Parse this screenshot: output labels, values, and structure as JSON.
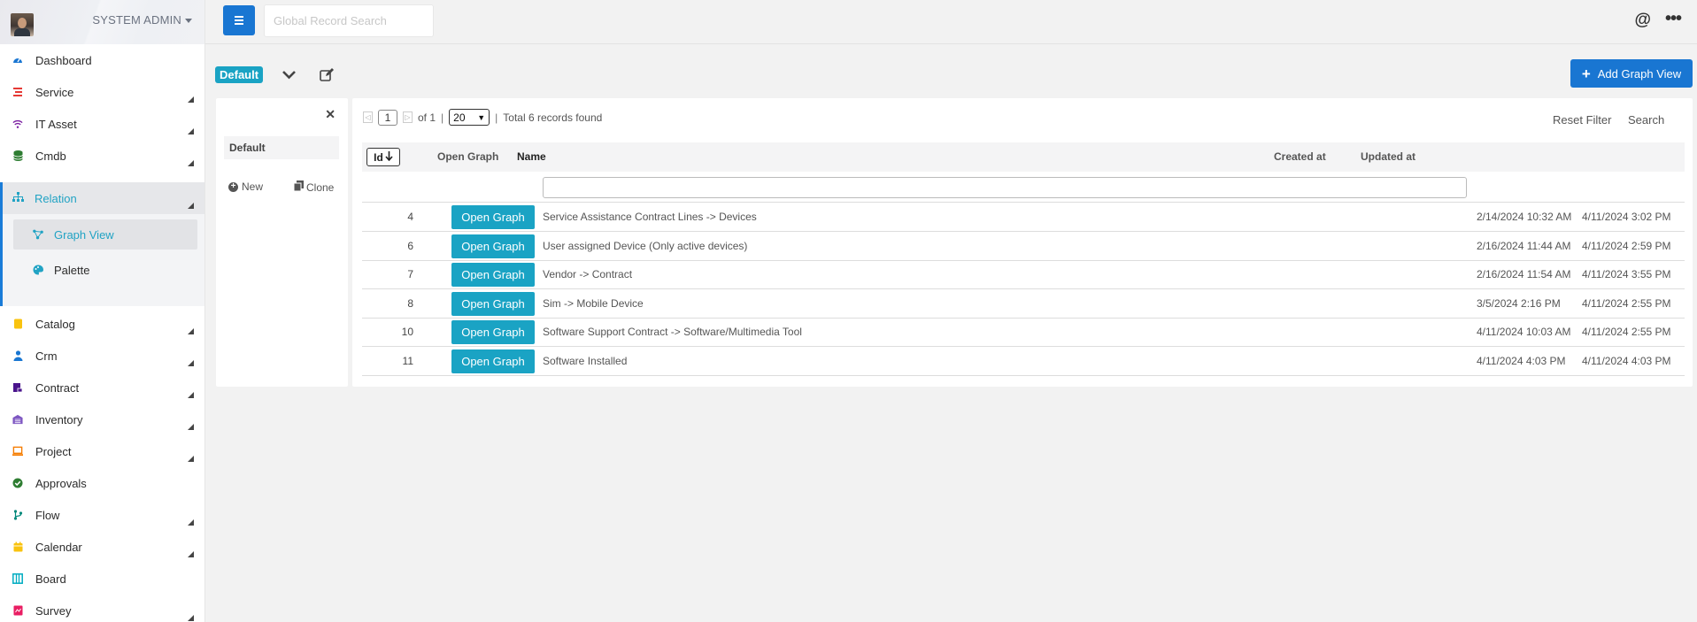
{
  "user": {
    "name": "SYSTEM ADMIN"
  },
  "topbar": {
    "search_placeholder": "Global Record Search"
  },
  "sidebar": {
    "items_top": [
      {
        "label": "Dashboard",
        "icon": "gauge-icon",
        "color": "#1976d2",
        "expandable": false
      },
      {
        "label": "Service",
        "icon": "list-icon",
        "color": "#e53935",
        "expandable": true
      },
      {
        "label": "IT Asset",
        "icon": "wifi-icon",
        "color": "#7b1fa2",
        "expandable": true
      },
      {
        "label": "Cmdb",
        "icon": "database-icon",
        "color": "#2e7d32",
        "expandable": true
      }
    ],
    "group": {
      "label": "Relation",
      "icon": "sitemap-icon",
      "color": "#21a3c4",
      "children": [
        {
          "label": "Graph View",
          "icon": "graph-icon",
          "active": true
        },
        {
          "label": "Palette",
          "icon": "palette-icon",
          "active": false
        }
      ]
    },
    "items_bottom": [
      {
        "label": "Catalog",
        "icon": "book-icon",
        "color": "#f9c30f",
        "expandable": true
      },
      {
        "label": "Crm",
        "icon": "user-icon",
        "color": "#1976d2",
        "expandable": true
      },
      {
        "label": "Contract",
        "icon": "contract-icon",
        "color": "#4a148c",
        "expandable": true
      },
      {
        "label": "Inventory",
        "icon": "warehouse-icon",
        "color": "#7e57c2",
        "expandable": true
      },
      {
        "label": "Project",
        "icon": "laptop-icon",
        "color": "#f57c00",
        "expandable": true
      },
      {
        "label": "Approvals",
        "icon": "check-circle-icon",
        "color": "#2e7d32",
        "expandable": false
      },
      {
        "label": "Flow",
        "icon": "flow-icon",
        "color": "#00897b",
        "expandable": true
      },
      {
        "label": "Calendar",
        "icon": "calendar-icon",
        "color": "#f9c30f",
        "expandable": true
      },
      {
        "label": "Board",
        "icon": "board-icon",
        "color": "#00acc1",
        "expandable": false
      },
      {
        "label": "Survey",
        "icon": "survey-icon",
        "color": "#e91e63",
        "expandable": true
      }
    ]
  },
  "viewbar": {
    "current_view": "Default",
    "add_label": "Add Graph View"
  },
  "views_panel": {
    "items": [
      "Default"
    ],
    "new_label": "New",
    "clone_label": "Clone"
  },
  "pager": {
    "page": "1",
    "of_text": "of 1",
    "page_size": "20",
    "total_text": "Total 6 records found"
  },
  "actions": {
    "reset_filter": "Reset Filter",
    "search": "Search"
  },
  "table": {
    "headers": {
      "id": "Id",
      "open_graph": "Open Graph",
      "name": "Name",
      "created": "Created at",
      "updated": "Updated at"
    },
    "button_label": "Open Graph",
    "rows": [
      {
        "id": "4",
        "name": "Service Assistance Contract Lines -> Devices",
        "created": "2/14/2024 10:32 AM",
        "updated": "4/11/2024 3:02 PM"
      },
      {
        "id": "6",
        "name": "User assigned Device (Only active devices)",
        "created": "2/16/2024 11:44 AM",
        "updated": "4/11/2024 2:59 PM"
      },
      {
        "id": "7",
        "name": "Vendor -> Contract",
        "created": "2/16/2024 11:54 AM",
        "updated": "4/11/2024 3:55 PM"
      },
      {
        "id": "8",
        "name": "Sim -> Mobile Device",
        "created": "3/5/2024 2:16 PM",
        "updated": "4/11/2024 2:55 PM"
      },
      {
        "id": "10",
        "name": "Software Support Contract -> Software/Multimedia Tool",
        "created": "4/11/2024 10:03 AM",
        "updated": "4/11/2024 2:55 PM"
      },
      {
        "id": "11",
        "name": "Software Installed",
        "created": "4/11/2024 4:03 PM",
        "updated": "4/11/2024 4:03 PM"
      }
    ]
  },
  "colors": {
    "primary": "#1976d2",
    "accent": "#1aa3c4"
  }
}
